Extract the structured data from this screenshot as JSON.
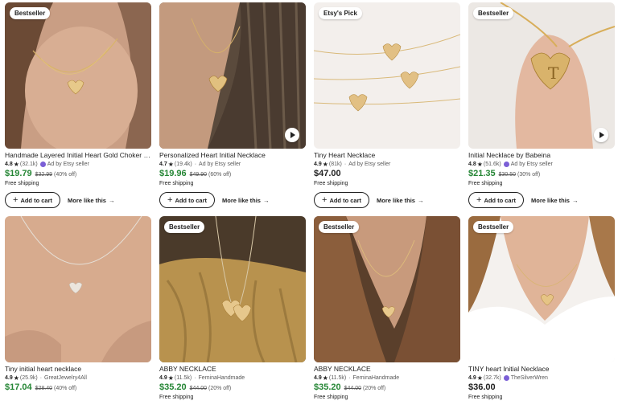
{
  "products": [
    {
      "title": "Handmade Layered Initial Heart Gold Choker N...",
      "badge": "Bestseller",
      "has_video": false,
      "rating": "4.8",
      "reviews": "(32.1k)",
      "seller": "Ad by Etsy seller",
      "seller_icon": "star-seller-icon",
      "price": "$19.79",
      "on_sale": true,
      "original_price": "$32.99",
      "discount": "(40% off)",
      "shipping": "Free shipping",
      "add_to_cart": "Add to cart",
      "more_like_this": "More like this"
    },
    {
      "title": "Personalized Heart Initial Necklace",
      "badge": "",
      "has_video": true,
      "rating": "4.7",
      "reviews": "(19.4k)",
      "seller": "Ad by Etsy seller",
      "seller_icon": "ad-icon",
      "price": "$19.96",
      "on_sale": true,
      "original_price": "$49.90",
      "discount": "(60% off)",
      "shipping": "Free shipping",
      "add_to_cart": "Add to cart",
      "more_like_this": "More like this"
    },
    {
      "title": "Tiny Heart Necklace",
      "badge": "Etsy's Pick",
      "has_video": false,
      "rating": "4.9",
      "reviews": "(81k)",
      "seller": "Ad by Etsy seller",
      "seller_icon": "ad-icon",
      "price": "$47.00",
      "on_sale": false,
      "original_price": "",
      "discount": "",
      "shipping": "Free shipping",
      "add_to_cart": "Add to cart",
      "more_like_this": "More like this"
    },
    {
      "title": "Initial Necklace by Babeina",
      "badge": "Bestseller",
      "has_video": true,
      "rating": "4.8",
      "reviews": "(51.6k)",
      "seller": "Ad by Etsy seller",
      "seller_icon": "star-seller-icon",
      "price": "$21.35",
      "on_sale": true,
      "original_price": "$30.50",
      "discount": "(30% off)",
      "shipping": "Free shipping",
      "add_to_cart": "Add to cart",
      "more_like_this": "More like this"
    },
    {
      "title": "Tiny initial heart necklace",
      "badge": "",
      "has_video": false,
      "rating": "4.9",
      "reviews": "(25.9k)",
      "seller": "GreatJewelry4All",
      "seller_icon": "",
      "price": "$17.04",
      "on_sale": true,
      "original_price": "$28.40",
      "discount": "(40% off)",
      "shipping": "",
      "add_to_cart": "",
      "more_like_this": ""
    },
    {
      "title": "ABBY NECKLACE",
      "badge": "Bestseller",
      "has_video": false,
      "rating": "4.9",
      "reviews": "(11.5k)",
      "seller": "FeminaHandmade",
      "seller_icon": "",
      "price": "$35.20",
      "on_sale": true,
      "original_price": "$44.00",
      "discount": "(20% off)",
      "shipping": "Free shipping",
      "add_to_cart": "",
      "more_like_this": ""
    },
    {
      "title": "ABBY NECKLACE",
      "badge": "Bestseller",
      "has_video": false,
      "rating": "4.9",
      "reviews": "(11.5k)",
      "seller": "FeminaHandmade",
      "seller_icon": "",
      "price": "$35.20",
      "on_sale": true,
      "original_price": "$44.00",
      "discount": "(20% off)",
      "shipping": "Free shipping",
      "add_to_cart": "",
      "more_like_this": ""
    },
    {
      "title": "TINY heart Initial Necklace",
      "badge": "Bestseller",
      "has_video": false,
      "rating": "4.9",
      "reviews": "(32.7k)",
      "seller": "TheSilverWren",
      "seller_icon": "star-seller-icon",
      "price": "$36.00",
      "on_sale": false,
      "original_price": "",
      "discount": "",
      "shipping": "Free shipping",
      "add_to_cart": "",
      "more_like_this": ""
    }
  ],
  "colors": {
    "sale_price": "#258635",
    "star_seller": "#7b5fd6",
    "text": "#222222",
    "muted": "#595959"
  }
}
